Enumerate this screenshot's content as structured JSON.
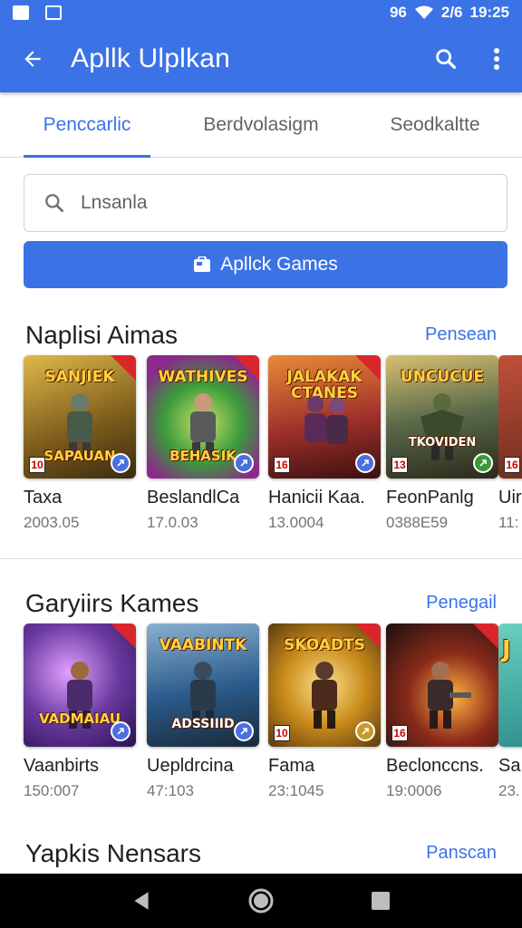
{
  "status_bar": {
    "time": "19:25",
    "signal_text": "96",
    "battery_text": "2/6"
  },
  "app_bar": {
    "title": "Apllk Ulplkan"
  },
  "tabs": [
    {
      "label": "Penccarlic",
      "active": true
    },
    {
      "label": "Berdvolasigm",
      "active": false
    },
    {
      "label": "Seodkaltte",
      "active": false
    }
  ],
  "search": {
    "placeholder": "Lnsanla"
  },
  "games_button": {
    "label": "Apllck Games"
  },
  "sections": [
    {
      "title": "Naplisi Aimas",
      "more": "Pensean",
      "items": [
        {
          "tile_title": "SANJIEK",
          "tile_sub": "SAPAUAN",
          "name": "Taxa",
          "sub": "2003.05",
          "age": "10",
          "theme": "#c89a2a"
        },
        {
          "tile_title": "WATHIVES",
          "tile_sub": "BEHASIK",
          "name": "BeslandlCa",
          "sub": "17.0.03",
          "age": "",
          "theme": "#3a9a3a"
        },
        {
          "tile_title": "JALAKAK CTANES",
          "tile_sub": "",
          "name": "Hanicii Kaa.",
          "sub": "13.0004",
          "age": "16",
          "theme": "#a0302a"
        },
        {
          "tile_title": "UNCUCUE",
          "tile_sub": "TKOVIDEN",
          "name": "FeonPanlg",
          "sub": "0388E59",
          "age": "13",
          "theme": "#4a5a3a"
        },
        {
          "tile_title": "",
          "tile_sub": "",
          "name": "Uir",
          "sub": "11:",
          "age": "16",
          "theme": "#9a3a2a"
        }
      ]
    },
    {
      "title": "Garyiirs Kames",
      "more": "Penegail",
      "items": [
        {
          "tile_title": "",
          "tile_sub": "VADMAIAU",
          "name": "Vaanbirts",
          "sub": "150:007",
          "age": "",
          "theme": "#6a3aa0"
        },
        {
          "tile_title": "VAABINTK",
          "tile_sub": "ADSSIIID",
          "name": "Uepldrcina",
          "sub": "47:103",
          "age": "",
          "theme": "#2a5a8a"
        },
        {
          "tile_title": "SKOADTS",
          "tile_sub": "",
          "name": "Fama",
          "sub": "23:1045",
          "age": "10",
          "theme": "#c88a1a"
        },
        {
          "tile_title": "",
          "tile_sub": "",
          "name": "Beclonccns.",
          "sub": "19:0006",
          "age": "16",
          "theme": "#8a2a1a"
        },
        {
          "tile_title": "J",
          "tile_sub": "",
          "name": "Sa",
          "sub": "23.",
          "age": "",
          "theme": "#2a8a8a"
        }
      ]
    },
    {
      "title": "Yapkis Nensars",
      "more": "Panscan"
    }
  ],
  "colors": {
    "primary": "#3b73e6",
    "nav_bg": "#000000"
  },
  "icons": {
    "back": "arrow-left-icon",
    "search": "search-icon",
    "menu": "more-vert-icon"
  }
}
